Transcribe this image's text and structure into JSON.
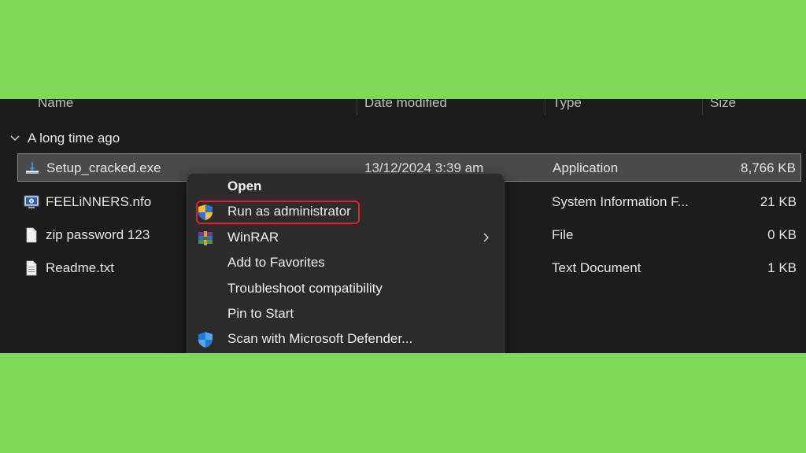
{
  "columns": {
    "name": "Name",
    "date": "Date modified",
    "type": "Type",
    "size": "Size"
  },
  "group": {
    "label": "A long time ago"
  },
  "files": [
    {
      "name": "Setup_cracked.exe",
      "date": "13/12/2024 3:39 am",
      "type": "Application",
      "size": "8,766 KB",
      "icon": "installer-icon"
    },
    {
      "name": "FEELiNNERS.nfo",
      "date": "",
      "type": "System Information F...",
      "size": "21 KB",
      "icon": "system-info-icon"
    },
    {
      "name": "zip password 123",
      "date": "",
      "type": "File",
      "size": "0 KB",
      "icon": "blank-file-icon"
    },
    {
      "name": "Readme.txt",
      "date": "",
      "type": "Text Document",
      "size": "1 KB",
      "icon": "text-document-icon"
    }
  ],
  "context_menu": {
    "items": [
      {
        "label": "Open",
        "icon": "",
        "bold": true
      },
      {
        "label": "Run as administrator",
        "icon": "uac-shield-icon"
      },
      {
        "label": "WinRAR",
        "icon": "winrar-icon",
        "submenu": true
      },
      {
        "label": "Add to Favorites",
        "icon": ""
      },
      {
        "label": "Troubleshoot compatibility",
        "icon": ""
      },
      {
        "label": "Pin to Start",
        "icon": ""
      },
      {
        "label": "Scan with Microsoft Defender...",
        "icon": "defender-shield-icon"
      }
    ]
  },
  "colors": {
    "background": "#7ed957",
    "panel": "#1c1c1c",
    "menu": "#2b2b2b",
    "selected_row": "#4a4a4a",
    "highlight_outline": "#e0202a"
  }
}
